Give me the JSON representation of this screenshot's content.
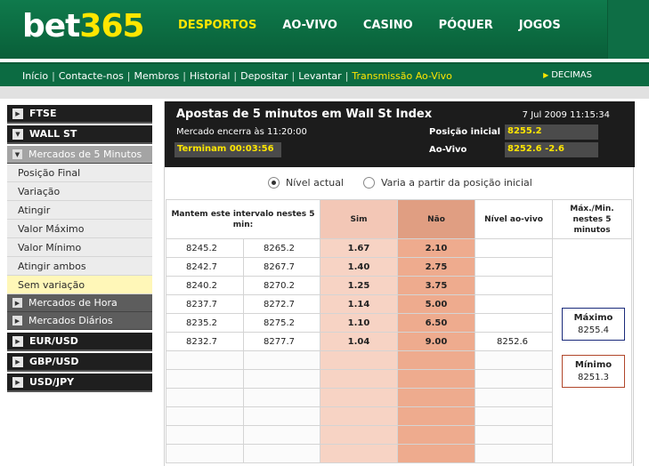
{
  "logo": {
    "white": "bet",
    "yellow": "365"
  },
  "topnav": [
    {
      "label": "DESPORTOS",
      "active": true
    },
    {
      "label": "AO-VIVO",
      "active": false
    },
    {
      "label": "CASINO",
      "active": false
    },
    {
      "label": "PÓQUER",
      "active": false
    },
    {
      "label": "JOGOS",
      "active": false
    }
  ],
  "subnav": {
    "links": [
      "Início",
      "Contacte-nos",
      "Membros",
      "Historial",
      "Depositar",
      "Levantar"
    ],
    "highlight": "Transmissão Ao-Vivo",
    "decimas": "DECIMAS"
  },
  "sidebar": {
    "ftse": "FTSE",
    "wallst": "WALL ST",
    "sub_5min": "Mercados de 5 Minutos",
    "items": [
      "Posição Final",
      "Variação",
      "Atingir",
      "Valor Máximo",
      "Valor Mínimo",
      "Atingir ambos",
      "Sem variação"
    ],
    "sub_hora": "Mercados de Hora",
    "sub_diarios": "Mercados Diários",
    "eurusd": "EUR/USD",
    "gbpusd": "GBP/USD",
    "usdjpy": "USD/JPY"
  },
  "panel": {
    "title": "Apostas de 5 minutos em Wall St Index",
    "datetime": "7 Jul 2009 11:15:34",
    "closes": "Mercado encerra às 11:20:00",
    "countdown": "Terminam 00:03:56",
    "pos_label": "Posição inicial",
    "pos_value": "8255.2",
    "live_label": "Ao-Vivo",
    "live_value": "8252.6   -2.6"
  },
  "radios": {
    "opt1": "Nível actual",
    "opt2": "Varia a partir da posição inicial"
  },
  "table": {
    "h_range": "Mantem este intervalo nestes 5 min:",
    "h_sim": "Sim",
    "h_nao": "Não",
    "h_live": "Nível ao-vivo",
    "h_mm": "Máx./Min. nestes 5 minutos",
    "rows": [
      {
        "a": "8245.2",
        "b": "8265.2",
        "sim": "1.67",
        "nao": "2.10",
        "live": ""
      },
      {
        "a": "8242.7",
        "b": "8267.7",
        "sim": "1.40",
        "nao": "2.75",
        "live": ""
      },
      {
        "a": "8240.2",
        "b": "8270.2",
        "sim": "1.25",
        "nao": "3.75",
        "live": ""
      },
      {
        "a": "8237.7",
        "b": "8272.7",
        "sim": "1.14",
        "nao": "5.00",
        "live": ""
      },
      {
        "a": "8235.2",
        "b": "8275.2",
        "sim": "1.10",
        "nao": "6.50",
        "live": ""
      },
      {
        "a": "8232.7",
        "b": "8277.7",
        "sim": "1.04",
        "nao": "9.00",
        "live": "8252.6"
      }
    ],
    "max_label": "Máximo",
    "max_value": "8255.4",
    "min_label": "Mínimo",
    "min_value": "8251.3"
  }
}
